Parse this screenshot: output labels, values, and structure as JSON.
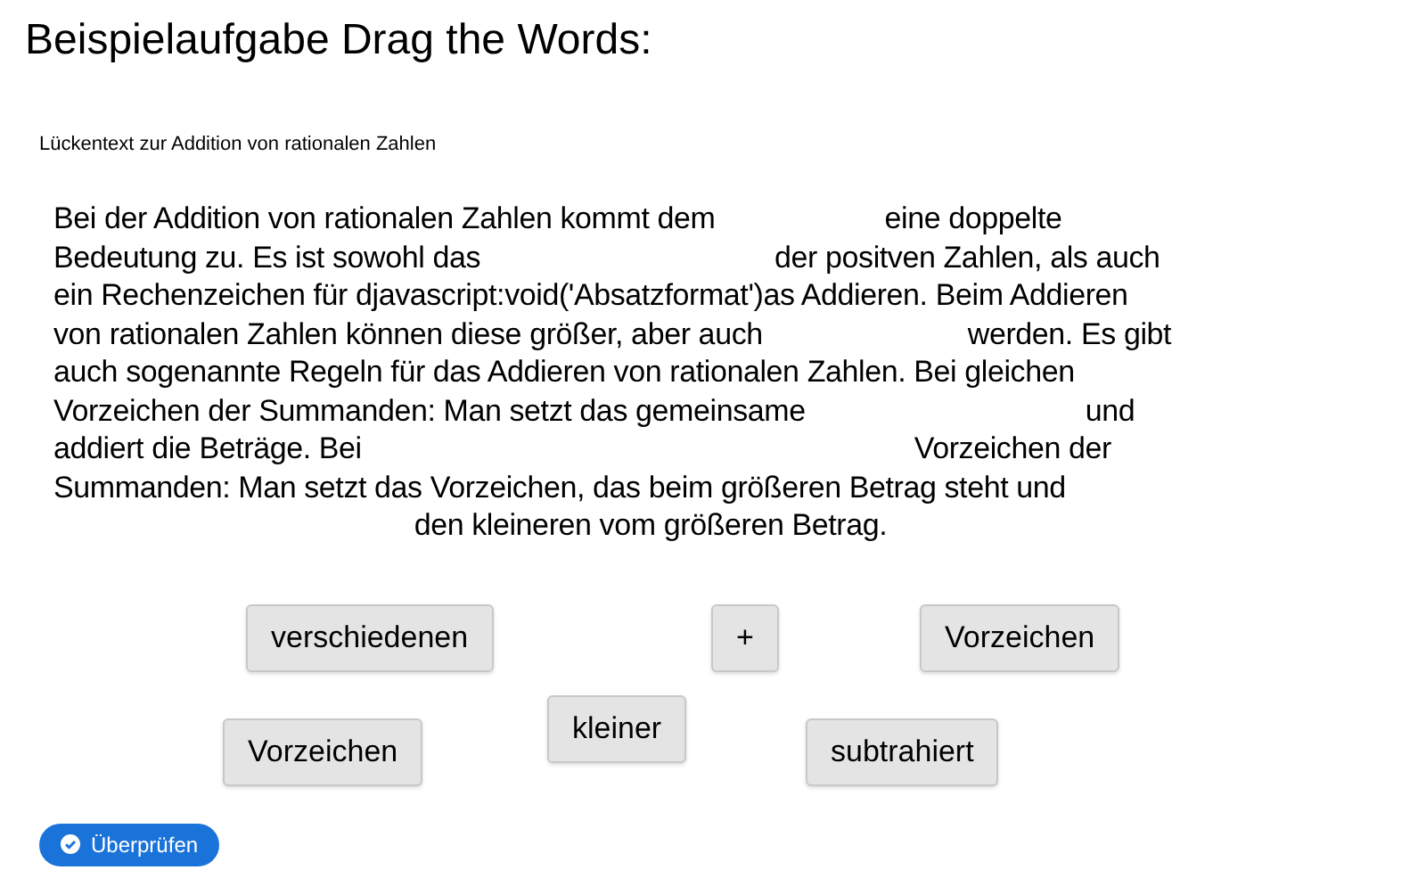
{
  "title": "Beispielaufgabe Drag the Words:",
  "subtitle": "Lückentext zur Addition von rationalen Zahlen",
  "paragraph_lines": [
    {
      "kind": "plain",
      "parts": [
        {
          "kind": "text",
          "text": "Bei der Addition von rationalen Zahlen kommt dem"
        },
        {
          "kind": "gap"
        },
        {
          "kind": "text",
          "text": "eine doppelte"
        }
      ]
    },
    {
      "kind": "plain",
      "parts": [
        {
          "kind": "text",
          "text": "Bedeutung zu. Es ist sowohl das"
        },
        {
          "kind": "gap"
        },
        {
          "kind": "text",
          "text": "der positven Zahlen, als auch"
        }
      ]
    },
    {
      "kind": "plain",
      "parts": [
        {
          "kind": "text",
          "text": "ein Rechenzeichen für djavascript:void('Absatzformat')as Addieren. Beim Addieren"
        }
      ]
    },
    {
      "kind": "plain",
      "parts": [
        {
          "kind": "text",
          "text": "von rationalen Zahlen können diese größer, aber auch"
        },
        {
          "kind": "gap"
        },
        {
          "kind": "text",
          "text": "werden. Es gibt"
        }
      ]
    },
    {
      "kind": "plain",
      "parts": [
        {
          "kind": "text",
          "text": "auch sogenannte Regeln für das Addieren von rationalen Zahlen. Bei gleichen"
        }
      ]
    },
    {
      "kind": "plain",
      "parts": [
        {
          "kind": "text",
          "text": "Vorzeichen der Summanden: Man setzt das gemeinsame"
        },
        {
          "kind": "gap"
        },
        {
          "kind": "text",
          "text": "und"
        }
      ]
    },
    {
      "kind": "plain",
      "parts": [
        {
          "kind": "text",
          "text": "addiert die Beträge. Bei"
        },
        {
          "kind": "gap"
        },
        {
          "kind": "text",
          "text": "Vorzeichen der"
        }
      ]
    },
    {
      "kind": "plain",
      "parts": [
        {
          "kind": "text",
          "text": "Summanden: Man setzt das Vorzeichen, das beim größeren Betrag steht und"
        }
      ]
    },
    {
      "kind": "centered",
      "parts": [
        {
          "kind": "text",
          "text": "den kleineren vom größeren Betrag."
        }
      ]
    }
  ],
  "words": [
    "verschiedenen",
    "+",
    "Vorzeichen",
    "Vorzeichen",
    "kleiner",
    "subtrahiert"
  ],
  "check_button": "Überprüfen"
}
